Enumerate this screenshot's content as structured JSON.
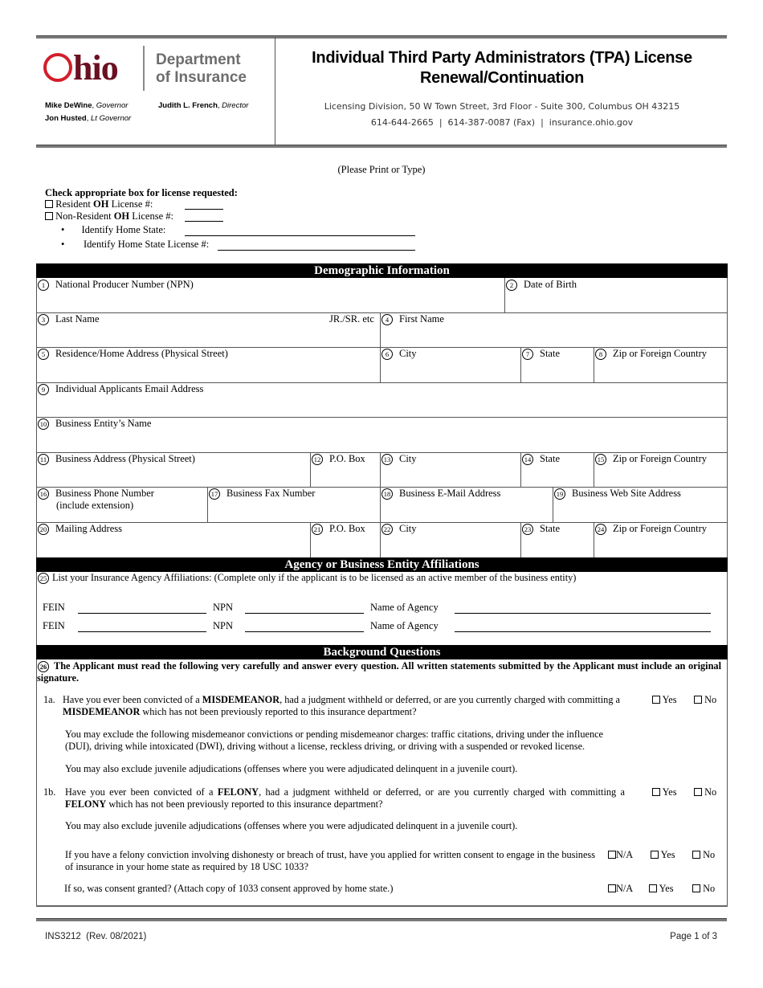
{
  "header": {
    "logo_word": "hio",
    "logo_letter": "O",
    "department_line1": "Department",
    "department_line2": "of Insurance",
    "officials": [
      {
        "name": "Mike DeWine",
        "title": "Governor"
      },
      {
        "name": "Jon Husted",
        "title": "Lt Governor"
      },
      {
        "name": "Judith L. French",
        "title": "Director"
      }
    ],
    "title_line1": "Individual Third Party Administrators (TPA) License",
    "title_line2": "Renewal/Continuation",
    "address": "Licensing Division, 50 W Town Street, 3rd Floor - Suite 300, Columbus OH 43215",
    "contact": "614-644-2665  |  614-387-0087 (Fax)  |  insurance.ohio.gov",
    "brand_colors": {
      "ohio_red": "#d21f2b",
      "ohio_maroon": "#6b1022",
      "dept_gray": "#6d6d6d"
    }
  },
  "instructions": {
    "print_note": "(Please Print or Type)",
    "license_heading": "Check appropriate box for license requested:",
    "resident_prefix": "Resident ",
    "resident_bold": "OH",
    "resident_suffix": " License #:",
    "nonresident_prefix": "Non-Resident ",
    "nonresident_bold": "OH",
    "nonresident_suffix": " License #:",
    "bullets": [
      "Identify Home State:",
      "Identify Home State License #:"
    ],
    "bullet_glyph": "•"
  },
  "sections": {
    "demographic": "Demographic Information",
    "affiliations": "Agency or Business Entity Affiliations",
    "background": "Background Questions"
  },
  "fields": [
    {
      "n": "1",
      "label": "National Producer Number (NPN)"
    },
    {
      "n": "2",
      "label": "Date of Birth"
    },
    {
      "n": "3",
      "label": "Last Name",
      "suffix": "JR./SR. etc"
    },
    {
      "n": "4",
      "label": "First Name"
    },
    {
      "n": "5",
      "label": "Residence/Home Address  (Physical Street)"
    },
    {
      "n": "6",
      "label": "City"
    },
    {
      "n": "7",
      "label": "State"
    },
    {
      "n": "8",
      "label": "Zip or Foreign Country"
    },
    {
      "n": "9",
      "label": "Individual Applicants Email Address"
    },
    {
      "n": "10",
      "label": "Business Entity’s Name"
    },
    {
      "n": "11",
      "label": "Business Address (Physical Street)"
    },
    {
      "n": "12",
      "label": "P.O. Box"
    },
    {
      "n": "13",
      "label": "City"
    },
    {
      "n": "14",
      "label": "State"
    },
    {
      "n": "15",
      "label": "Zip or Foreign Country"
    },
    {
      "n": "16",
      "label": "Business Phone Number",
      "label2": "(include extension)"
    },
    {
      "n": "17",
      "label": "Business Fax Number"
    },
    {
      "n": "18",
      "label": "Business E-Mail Address"
    },
    {
      "n": "19",
      "label": "Business Web Site Address"
    },
    {
      "n": "20",
      "label": "Mailing Address"
    },
    {
      "n": "21",
      "label": "P.O. Box"
    },
    {
      "n": "22",
      "label": "City"
    },
    {
      "n": "23",
      "label": "State"
    },
    {
      "n": "24",
      "label": "Zip or Foreign Country"
    }
  ],
  "affiliations": {
    "n": "25",
    "intro": "List your Insurance Agency Affiliations: (Complete only if the applicant is to be licensed as an active member of the business entity)",
    "rows": [
      {
        "fein": "FEIN",
        "npn": "NPN",
        "agency": "Name of Agency"
      },
      {
        "fein": "FEIN",
        "npn": "NPN",
        "agency": "Name of Agency"
      }
    ]
  },
  "background": {
    "n": "26",
    "intro": "The Applicant must read the following very carefully and answer every question. All written statements submitted by the Applicant must include an original signature.",
    "q1a_num": "1a.",
    "q1a_p1": "Have you ever been convicted of a ",
    "q1a_b1": "MISDEMEANOR",
    "q1a_p2": ", had a judgment withheld or deferred, or are you currently charged with committing a ",
    "q1a_b2": "MISDEMEANOR",
    "q1a_p3": " which has not been previously reported to this insurance department?",
    "q1a_note1": "You may exclude the following misdemeanor convictions or pending misdemeanor charges: traffic citations, driving under the influence (DUI), driving while intoxicated (DWI), driving without a license, reckless driving, or driving with a suspended or revoked license.",
    "q1a_note2": "You may also exclude juvenile adjudications (offenses where you were adjudicated delinquent in a juvenile court).",
    "q1b_num": "1b.",
    "q1b_p1": "Have you ever been convicted of a ",
    "q1b_b1": "FELONY",
    "q1b_p2": ", had a judgment withheld or deferred, or are you currently charged with committing a ",
    "q1b_b2": "FELONY",
    "q1b_p3": " which has not been previously reported to this insurance department?",
    "q1b_note": "You may also exclude juvenile adjudications (offenses where you were adjudicated delinquent in a juvenile court).",
    "q_1033": "If you have a felony conviction involving dishonesty or breach of trust, have you applied for written consent to engage in the business of insurance in your home state as required by 18 USC 1033?",
    "q_consent": "If so, was consent granted? (Attach copy of 1033 consent approved by home state.)",
    "opt_yes": "Yes",
    "opt_no": "No",
    "opt_na": "N/A"
  },
  "footer": {
    "form_id": "INS3212  (Rev. 08/2021)",
    "page": "Page 1 of 3"
  }
}
